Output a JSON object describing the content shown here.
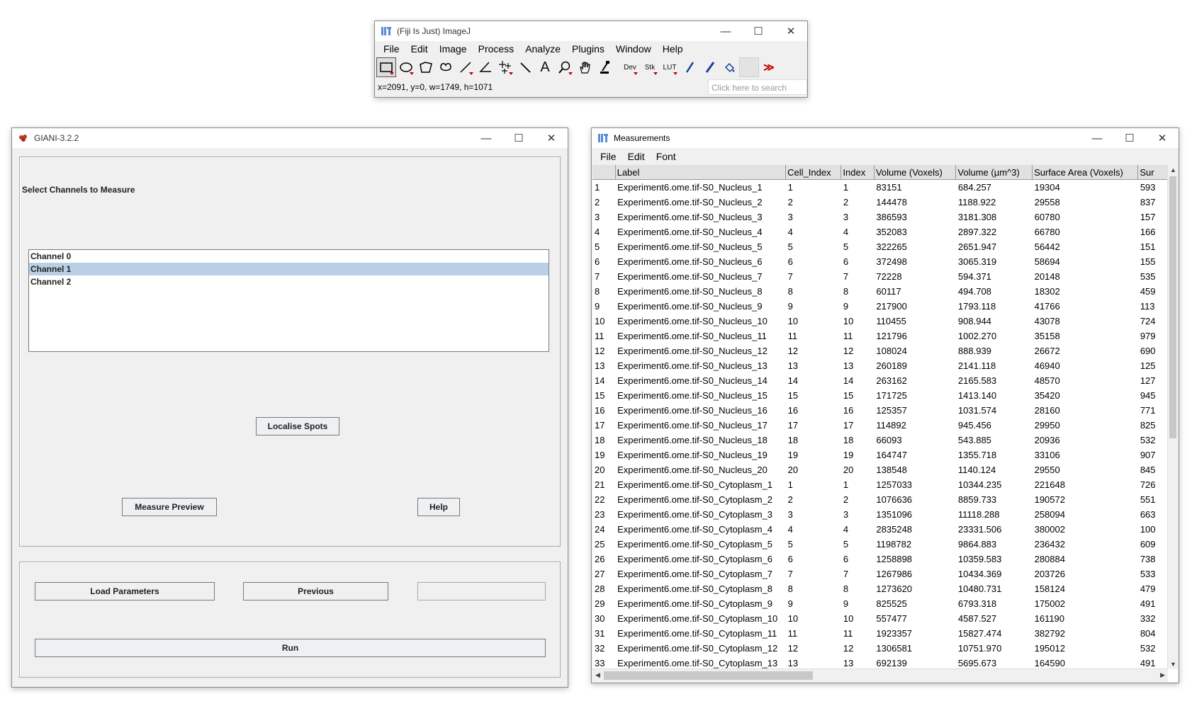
{
  "imagej": {
    "title": "(Fiji Is Just) ImageJ",
    "menu": [
      "File",
      "Edit",
      "Image",
      "Process",
      "Analyze",
      "Plugins",
      "Window",
      "Help"
    ],
    "tool_labels": {
      "dev": "Dev",
      "stk": "Stk",
      "lut": "LUT",
      "more": "≫"
    },
    "status": "x=2091, y=0, w=1749, h=1071",
    "search_placeholder": "Click here to search"
  },
  "giani": {
    "title": "GIANI-3.2.2",
    "heading": "Select Channels to Measure",
    "channels": [
      "Channel 0",
      "Channel 1",
      "Channel 2"
    ],
    "selected_channel": 1,
    "buttons": {
      "localise": "Localise Spots",
      "measure_preview": "Measure Preview",
      "help": "Help",
      "load": "Load Parameters",
      "previous": "Previous",
      "next": "",
      "run": "Run"
    }
  },
  "measurements": {
    "title": "Measurements",
    "menu": [
      "File",
      "Edit",
      "Font"
    ],
    "columns": [
      "",
      "Label",
      "Cell_Index",
      "Index",
      "Volume (Voxels)",
      "Volume (µm^3)",
      "Surface Area (Voxels)",
      "Sur"
    ],
    "rows": [
      [
        "1",
        "Experiment6.ome.tif-S0_Nucleus_1",
        "1",
        "1",
        "83151",
        "684.257",
        "19304",
        "593"
      ],
      [
        "2",
        "Experiment6.ome.tif-S0_Nucleus_2",
        "2",
        "2",
        "144478",
        "1188.922",
        "29558",
        "837"
      ],
      [
        "3",
        "Experiment6.ome.tif-S0_Nucleus_3",
        "3",
        "3",
        "386593",
        "3181.308",
        "60780",
        "157"
      ],
      [
        "4",
        "Experiment6.ome.tif-S0_Nucleus_4",
        "4",
        "4",
        "352083",
        "2897.322",
        "66780",
        "166"
      ],
      [
        "5",
        "Experiment6.ome.tif-S0_Nucleus_5",
        "5",
        "5",
        "322265",
        "2651.947",
        "56442",
        "151"
      ],
      [
        "6",
        "Experiment6.ome.tif-S0_Nucleus_6",
        "6",
        "6",
        "372498",
        "3065.319",
        "58694",
        "155"
      ],
      [
        "7",
        "Experiment6.ome.tif-S0_Nucleus_7",
        "7",
        "7",
        "72228",
        "594.371",
        "20148",
        "535"
      ],
      [
        "8",
        "Experiment6.ome.tif-S0_Nucleus_8",
        "8",
        "8",
        "60117",
        "494.708",
        "18302",
        "459"
      ],
      [
        "9",
        "Experiment6.ome.tif-S0_Nucleus_9",
        "9",
        "9",
        "217900",
        "1793.118",
        "41766",
        "113"
      ],
      [
        "10",
        "Experiment6.ome.tif-S0_Nucleus_10",
        "10",
        "10",
        "110455",
        "908.944",
        "43078",
        "724"
      ],
      [
        "11",
        "Experiment6.ome.tif-S0_Nucleus_11",
        "11",
        "11",
        "121796",
        "1002.270",
        "35158",
        "979"
      ],
      [
        "12",
        "Experiment6.ome.tif-S0_Nucleus_12",
        "12",
        "12",
        "108024",
        "888.939",
        "26672",
        "690"
      ],
      [
        "13",
        "Experiment6.ome.tif-S0_Nucleus_13",
        "13",
        "13",
        "260189",
        "2141.118",
        "46940",
        "125"
      ],
      [
        "14",
        "Experiment6.ome.tif-S0_Nucleus_14",
        "14",
        "14",
        "263162",
        "2165.583",
        "48570",
        "127"
      ],
      [
        "15",
        "Experiment6.ome.tif-S0_Nucleus_15",
        "15",
        "15",
        "171725",
        "1413.140",
        "35420",
        "945"
      ],
      [
        "16",
        "Experiment6.ome.tif-S0_Nucleus_16",
        "16",
        "16",
        "125357",
        "1031.574",
        "28160",
        "771"
      ],
      [
        "17",
        "Experiment6.ome.tif-S0_Nucleus_17",
        "17",
        "17",
        "114892",
        "945.456",
        "29950",
        "825"
      ],
      [
        "18",
        "Experiment6.ome.tif-S0_Nucleus_18",
        "18",
        "18",
        "66093",
        "543.885",
        "20936",
        "532"
      ],
      [
        "19",
        "Experiment6.ome.tif-S0_Nucleus_19",
        "19",
        "19",
        "164747",
        "1355.718",
        "33106",
        "907"
      ],
      [
        "20",
        "Experiment6.ome.tif-S0_Nucleus_20",
        "20",
        "20",
        "138548",
        "1140.124",
        "29550",
        "845"
      ],
      [
        "21",
        "Experiment6.ome.tif-S0_Cytoplasm_1",
        "1",
        "1",
        "1257033",
        "10344.235",
        "221648",
        "726"
      ],
      [
        "22",
        "Experiment6.ome.tif-S0_Cytoplasm_2",
        "2",
        "2",
        "1076636",
        "8859.733",
        "190572",
        "551"
      ],
      [
        "23",
        "Experiment6.ome.tif-S0_Cytoplasm_3",
        "3",
        "3",
        "1351096",
        "11118.288",
        "258094",
        "663"
      ],
      [
        "24",
        "Experiment6.ome.tif-S0_Cytoplasm_4",
        "4",
        "4",
        "2835248",
        "23331.506",
        "380002",
        "100"
      ],
      [
        "25",
        "Experiment6.ome.tif-S0_Cytoplasm_5",
        "5",
        "5",
        "1198782",
        "9864.883",
        "236432",
        "609"
      ],
      [
        "26",
        "Experiment6.ome.tif-S0_Cytoplasm_6",
        "6",
        "6",
        "1258898",
        "10359.583",
        "280884",
        "738"
      ],
      [
        "27",
        "Experiment6.ome.tif-S0_Cytoplasm_7",
        "7",
        "7",
        "1267986",
        "10434.369",
        "203726",
        "533"
      ],
      [
        "28",
        "Experiment6.ome.tif-S0_Cytoplasm_8",
        "8",
        "8",
        "1273620",
        "10480.731",
        "158124",
        "479"
      ],
      [
        "29",
        "Experiment6.ome.tif-S0_Cytoplasm_9",
        "9",
        "9",
        "825525",
        "6793.318",
        "175002",
        "491"
      ],
      [
        "30",
        "Experiment6.ome.tif-S0_Cytoplasm_10",
        "10",
        "10",
        "557477",
        "4587.527",
        "161190",
        "332"
      ],
      [
        "31",
        "Experiment6.ome.tif-S0_Cytoplasm_11",
        "11",
        "11",
        "1923357",
        "15827.474",
        "382792",
        "804"
      ],
      [
        "32",
        "Experiment6.ome.tif-S0_Cytoplasm_12",
        "12",
        "12",
        "1306581",
        "10751.970",
        "195012",
        "532"
      ],
      [
        "33",
        "Experiment6.ome.tif-S0_Cytoplasm_13",
        "13",
        "13",
        "692139",
        "5695.673",
        "164590",
        "491"
      ]
    ]
  },
  "window_controls": {
    "minimize": "—",
    "maximize": "☐",
    "close": "✕"
  },
  "colors": {
    "selection": "#b8cfe5",
    "accent": "#c00000"
  }
}
